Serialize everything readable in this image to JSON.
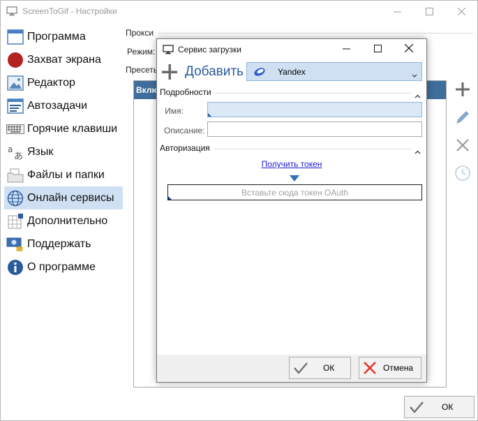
{
  "main_window": {
    "title": "ScreenToGif - Настройки"
  },
  "sidebar": {
    "items": [
      {
        "label": "Программа",
        "icon": "window-icon"
      },
      {
        "label": "Захват экрана",
        "icon": "record-icon"
      },
      {
        "label": "Редактор",
        "icon": "image-editor-icon"
      },
      {
        "label": "Автозадачи",
        "icon": "tasks-icon"
      },
      {
        "label": "Горячие клавиши",
        "icon": "keyboard-icon"
      },
      {
        "label": "Язык",
        "icon": "language-icon"
      },
      {
        "label": "Файлы и папки",
        "icon": "folder-icon"
      },
      {
        "label": "Онлайн сервисы",
        "icon": "globe-icon"
      },
      {
        "label": "Дополнительно",
        "icon": "extras-icon"
      },
      {
        "label": "Поддержать",
        "icon": "donate-icon"
      },
      {
        "label": "О программе",
        "icon": "info-icon"
      }
    ],
    "selected_index": 7
  },
  "content": {
    "proxy_label": "Прокси",
    "mode_label": "Режим:",
    "presets_label": "Пресеты",
    "list_header_partial": "Включ"
  },
  "main_footer": {
    "ok_label": "ОК"
  },
  "dialog": {
    "title": "Сервис загрузки",
    "add_label": "Добавить",
    "service_selected": "Yandex",
    "details_header": "Подробности",
    "name_label": "Имя:",
    "name_value": "",
    "description_label": "Описание:",
    "description_value": "",
    "auth_header": "Авторизация",
    "get_token_link": "Получить токен",
    "token_placeholder": "Вставьте сюда токен OAuth",
    "ok_label": "ОК",
    "cancel_label": "Отмена"
  },
  "colors": {
    "selection": "#cfe0f2",
    "list_header": "#3f6e9c",
    "link": "#1a1ad8",
    "accent": "#2a5b9c",
    "cancel_red": "#e0382a"
  }
}
